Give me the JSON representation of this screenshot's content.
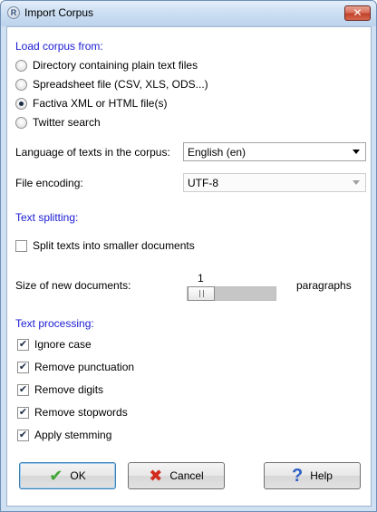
{
  "window": {
    "title": "Import Corpus",
    "close_glyph": "✕",
    "app_icon": "R"
  },
  "load_corpus": {
    "heading": "Load corpus from:",
    "options": [
      {
        "label": "Directory containing plain text files",
        "selected": false
      },
      {
        "label": "Spreadsheet file (CSV, XLS, ODS...)",
        "selected": false
      },
      {
        "label": "Factiva XML or HTML file(s)",
        "selected": true
      },
      {
        "label": "Twitter search",
        "selected": false
      }
    ]
  },
  "language": {
    "label": "Language of texts in the corpus:",
    "value": "English (en)"
  },
  "encoding": {
    "label": "File encoding:",
    "value": "UTF-8"
  },
  "text_splitting": {
    "heading": "Text splitting:",
    "split_label": "Split texts into smaller documents",
    "split_checked": false,
    "size_label": "Size of new documents:",
    "size_value": "1",
    "size_unit": "paragraphs"
  },
  "text_processing": {
    "heading": "Text processing:",
    "options": [
      {
        "label": "Ignore case",
        "checked": true,
        "glyph": "✔"
      },
      {
        "label": "Remove punctuation",
        "checked": true,
        "glyph": "✔"
      },
      {
        "label": "Remove digits",
        "checked": true,
        "glyph": "✔"
      },
      {
        "label": "Remove stopwords",
        "checked": true,
        "glyph": "✔"
      },
      {
        "label": "Apply stemming",
        "checked": true,
        "glyph": "✔"
      }
    ]
  },
  "buttons": {
    "ok": {
      "label": "OK",
      "icon": "✔"
    },
    "cancel": {
      "label": "Cancel",
      "icon": "✖"
    },
    "help": {
      "label": "Help",
      "icon": "?"
    }
  },
  "colors": {
    "section_heading": "#1a1ad6",
    "ok_icon": "#3fa535",
    "cancel_icon": "#d22a1e",
    "help_icon": "#2d5fc6"
  }
}
